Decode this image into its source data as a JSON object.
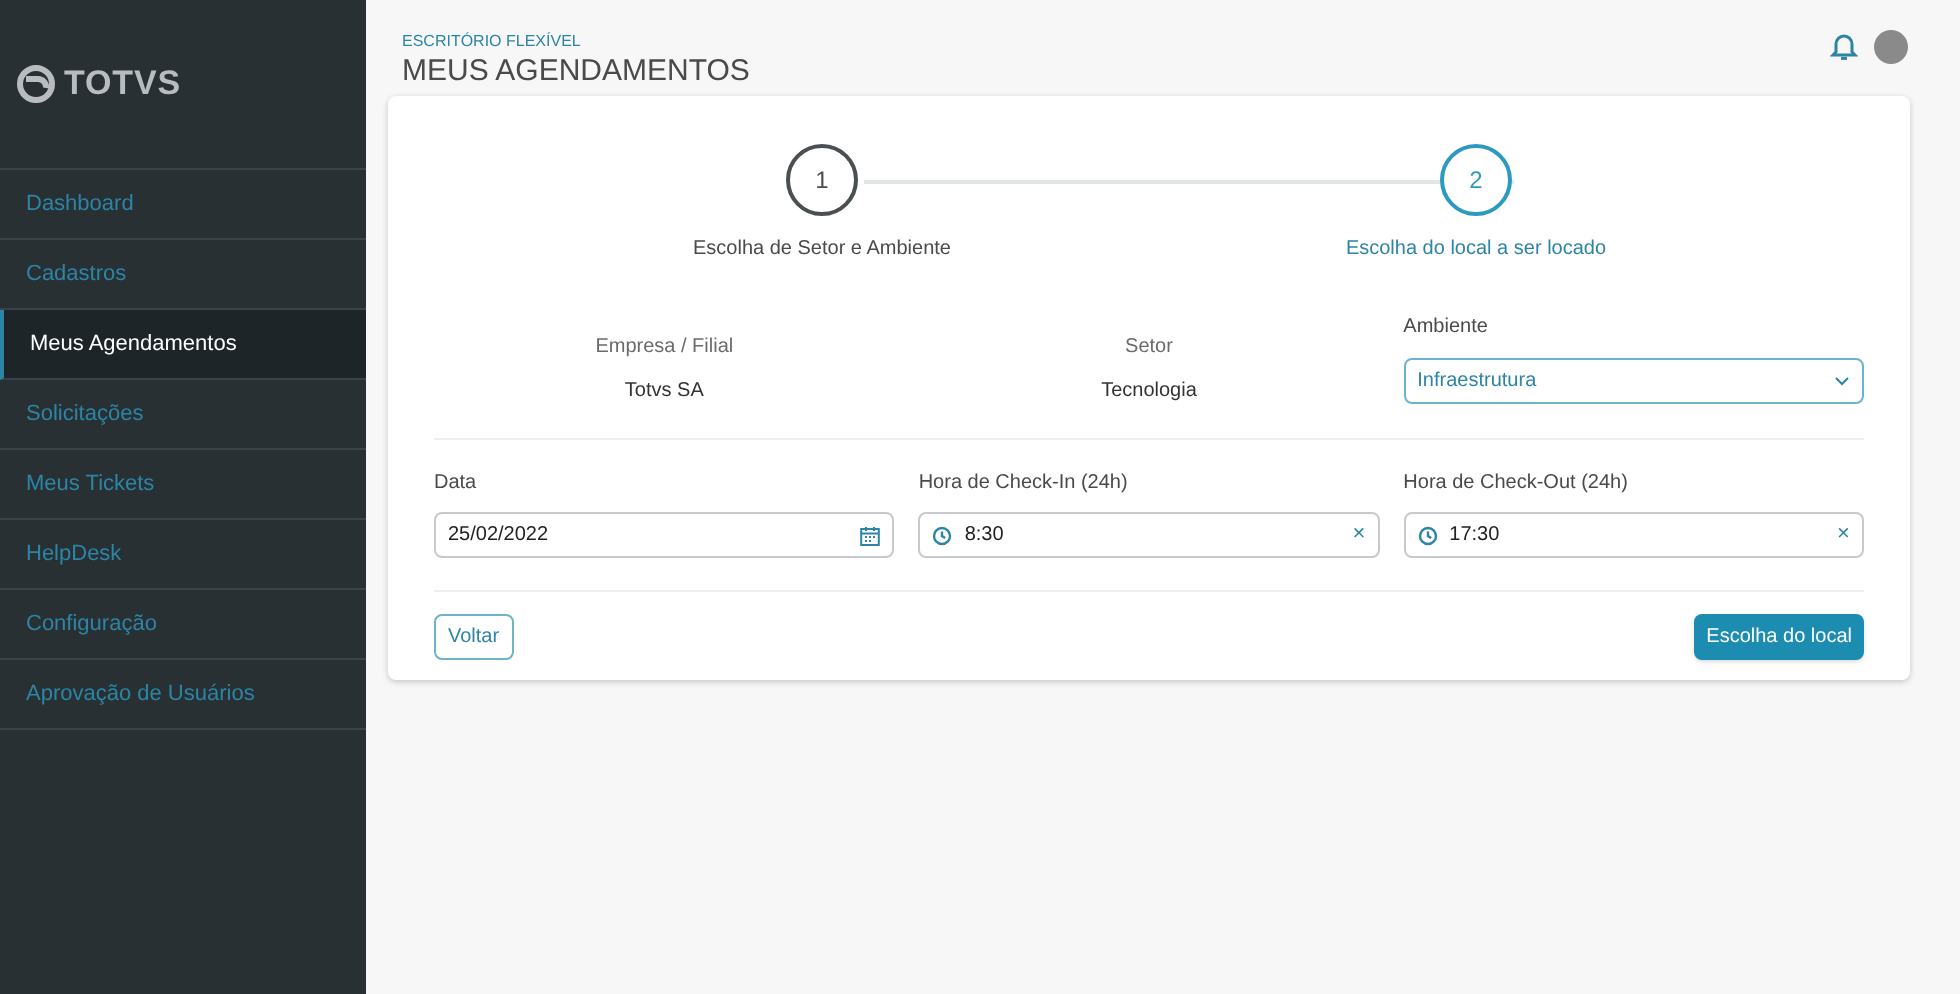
{
  "brand": {
    "name": "TOTVS"
  },
  "sidebar": {
    "items": [
      {
        "label": "Dashboard",
        "selected": false
      },
      {
        "label": "Cadastros",
        "selected": false
      },
      {
        "label": "Meus Agendamentos",
        "selected": true
      },
      {
        "label": "Solicitações",
        "selected": false
      },
      {
        "label": "Meus Tickets",
        "selected": false
      },
      {
        "label": "HelpDesk",
        "selected": false
      },
      {
        "label": "Configuração",
        "selected": false
      },
      {
        "label": "Aprovação de Usuários",
        "selected": false
      }
    ]
  },
  "header": {
    "breadcrumb": "ESCRITÓRIO FLEXÍVEL",
    "title": "MEUS AGENDAMENTOS"
  },
  "stepper": [
    {
      "number": "1",
      "label": "Escolha de Setor e Ambiente",
      "selected": false
    },
    {
      "number": "2",
      "label": "Escolha do local a ser locado",
      "selected": true
    }
  ],
  "info": [
    {
      "label": "Empresa / Filial",
      "value": "Totvs SA"
    },
    {
      "label": "Setor",
      "value": "Tecnologia"
    }
  ],
  "ambiente": {
    "label": "Ambiente",
    "value": "Infraestrutura"
  },
  "fields": [
    {
      "kind": "date",
      "label": "Data",
      "value": "25/02/2022"
    },
    {
      "kind": "time",
      "label": "Hora de Check-In (24h)",
      "value": "8:30",
      "clear": "×"
    },
    {
      "kind": "time",
      "label": "Hora de Check-Out (24h)",
      "value": "17:30",
      "clear": "×"
    }
  ],
  "buttons": {
    "back": "Voltar",
    "next": "Escolha do local"
  }
}
